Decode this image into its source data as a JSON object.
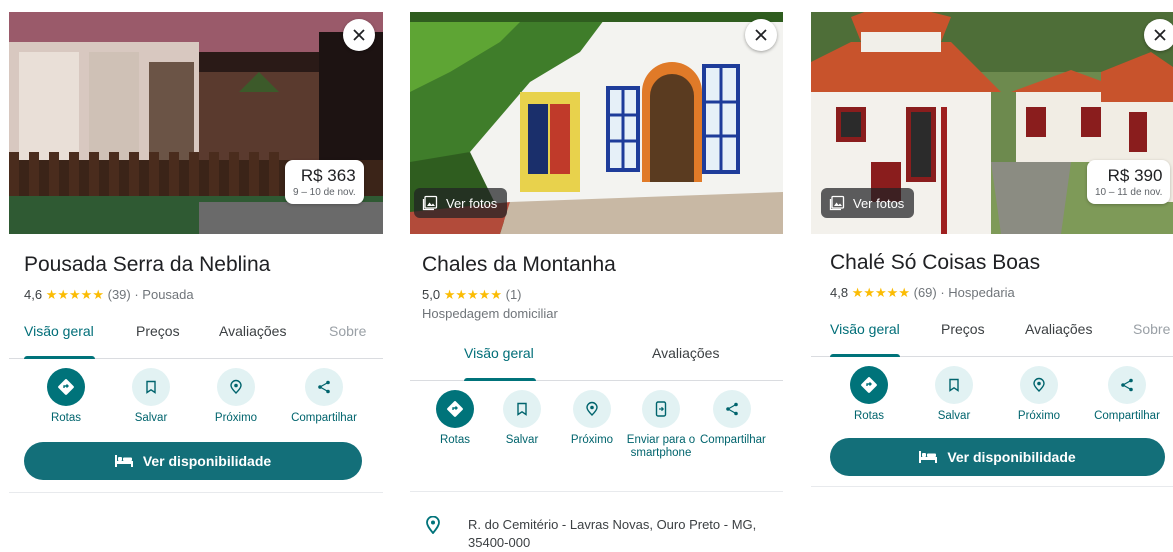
{
  "cards": [
    {
      "title": "Pousada Serra da Neblina",
      "rating": "4,6",
      "stars": "★★★★★",
      "reviews": "(39)",
      "type": " · Pousada",
      "price": "R$ 363",
      "dates": "9 – 10 de nov.",
      "tabs": [
        "Visão geral",
        "Preços",
        "Avaliações",
        "Sobre"
      ],
      "actions": [
        "Rotas",
        "Salvar",
        "Próximo",
        "Compartilhar"
      ],
      "availability": "Ver disponibilidade"
    },
    {
      "title": "Chales da Montanha",
      "rating": "5,0",
      "stars": "★★★★★",
      "reviews": "(1)",
      "subtype": "Hospedagem domiciliar",
      "ver_fotos": "Ver fotos",
      "tabs": [
        "Visão geral",
        "Avaliações"
      ],
      "actions": [
        "Rotas",
        "Salvar",
        "Próximo",
        "Enviar para o smartphone",
        "Compartilhar"
      ],
      "address": "R. do Cemitério - Lavras Novas, Ouro Preto - MG, 35400-000"
    },
    {
      "title": "Chalé Só Coisas Boas",
      "rating": "4,8",
      "stars": "★★★★★",
      "reviews": "(69)",
      "type": " · Hospedaria",
      "price": "R$ 390",
      "dates": "10 – 11 de nov.",
      "ver_fotos": "Ver fotos",
      "tabs": [
        "Visão geral",
        "Preços",
        "Avaliações",
        "Sobre"
      ],
      "actions": [
        "Rotas",
        "Salvar",
        "Próximo",
        "Compartilhar"
      ],
      "availability": "Ver disponibilidade"
    }
  ],
  "icons": {
    "close": "close-icon",
    "directions": "directions-icon",
    "save": "bookmark-icon",
    "nearby": "nearby-icon",
    "send": "send-to-phone-icon",
    "share": "share-icon",
    "bed": "bed-icon",
    "photos": "photo-icon",
    "pin": "location-pin-icon"
  },
  "colors": {
    "accent": "#00737a",
    "star": "#fbbc04",
    "button": "#136f79"
  }
}
